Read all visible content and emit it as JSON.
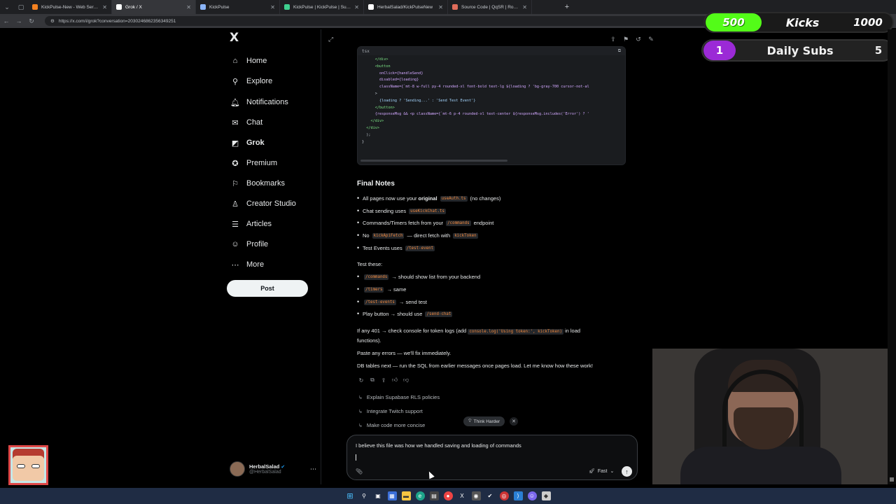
{
  "browser": {
    "tabs": [
      {
        "label": "KickPulse-New - Web Service • Re",
        "color": "#f48120"
      },
      {
        "label": "Grok / X",
        "color": "#ffffff"
      },
      {
        "label": "KickPulse",
        "color": "#8ab4f8"
      },
      {
        "label": "KickPulse | KickPulse | Supabase",
        "color": "#3ecf8e"
      },
      {
        "label": "HerbalSalad/KickPulseNew",
        "color": "#ffffff"
      },
      {
        "label": "Source Code | QqSR | Rocket Pow",
        "color": "#e06c5a"
      }
    ],
    "url": "https://x.com/i/grok?conversation=2030246862356349251"
  },
  "sidebar": {
    "logo": "X",
    "items": [
      {
        "label": "Home",
        "icon": "home-icon",
        "glyph": "⌂"
      },
      {
        "label": "Explore",
        "icon": "search-icon",
        "glyph": "⚲"
      },
      {
        "label": "Notifications",
        "icon": "bell-icon",
        "glyph": "🔔︎"
      },
      {
        "label": "Chat",
        "icon": "mail-icon",
        "glyph": "✉"
      },
      {
        "label": "Grok",
        "icon": "grok-icon",
        "glyph": "◩"
      },
      {
        "label": "Premium",
        "icon": "premium-icon",
        "glyph": "✪"
      },
      {
        "label": "Bookmarks",
        "icon": "bookmark-icon",
        "glyph": "⚐"
      },
      {
        "label": "Creator Studio",
        "icon": "creator-icon",
        "glyph": "♙"
      },
      {
        "label": "Articles",
        "icon": "articles-icon",
        "glyph": "☰"
      },
      {
        "label": "Profile",
        "icon": "profile-icon",
        "glyph": "☺"
      },
      {
        "label": "More",
        "icon": "more-circle-icon",
        "glyph": "⋯"
      }
    ],
    "post_label": "Post",
    "account": {
      "display_name": "HerbalSalad",
      "handle": "@HerbalSalad"
    }
  },
  "code": {
    "lang": "tsx",
    "lines": [
      "      </div>",
      "",
      "      <button",
      "        onClick={handleSend}",
      "        disabled={loading}",
      "        className={`mt-8 w-full py-4 rounded-xl font-bold text-lg ${loading ? 'bg-gray-700 cursor-not-al",
      "      >",
      "        {loading ? 'Sending...' : 'Send Test Event'}",
      "      </button>",
      "",
      "      {responseMsg && <p className={`mt-6 p-4 rounded-xl text-center ${responseMsg.includes('Error') ? '",
      "    </div>",
      "  </div>",
      "  );",
      "}"
    ]
  },
  "answer": {
    "heading": "Final Notes",
    "bullets1": [
      {
        "pre": "All pages now use your ",
        "bold": "original",
        "code": "useAuth.ts",
        "post": "(no changes)"
      },
      {
        "pre": "Chat sending uses",
        "bold": "",
        "code": "useKickChat.ts",
        "post": ""
      },
      {
        "pre": "Commands/Timers fetch from your",
        "bold": "",
        "code": "/commands",
        "post": "endpoint"
      },
      {
        "pre": "No",
        "bold": "",
        "code": "kickApiFetch",
        "post": "— direct fetch with",
        "code2": "kickToken"
      },
      {
        "pre": "Test Events uses",
        "bold": "",
        "code": "/test-event",
        "post": ""
      }
    ],
    "test_label": "Test these:",
    "bullets2": [
      {
        "pre": "",
        "code": "/commands",
        "post": "→ should show list from your backend"
      },
      {
        "pre": "",
        "code": "/timers",
        "post": "→ same"
      },
      {
        "pre": "",
        "code": "/test-events",
        "post": "→ send test"
      },
      {
        "pre": "Play button → should use",
        "code": "/send-chat",
        "post": ""
      }
    ],
    "p401_pre": "If any 401 → check console for token logs (add",
    "p401_code": "console.log('Using token:', kickToken)",
    "p401_post": "in load",
    "p401_line2": "functions).",
    "p_errors": "Paste any errors — we'll fix immediately.",
    "p_db": "DB tables next — run the SQL from earlier messages once pages load. Let me know how these work!"
  },
  "suggestions": [
    "Explain Supabase RLS policies",
    "Integrate Twitch support",
    "Make code more concise"
  ],
  "think_harder": "Think Harder",
  "composer": {
    "text": "I believe this file was how we handled saving and loading of commands",
    "mode": "Fast"
  },
  "overlay": {
    "kicks": {
      "left": "500",
      "label": "Kicks",
      "right": "1000"
    },
    "subs": {
      "left": "1",
      "label": "Daily Subs",
      "right": "5"
    }
  }
}
